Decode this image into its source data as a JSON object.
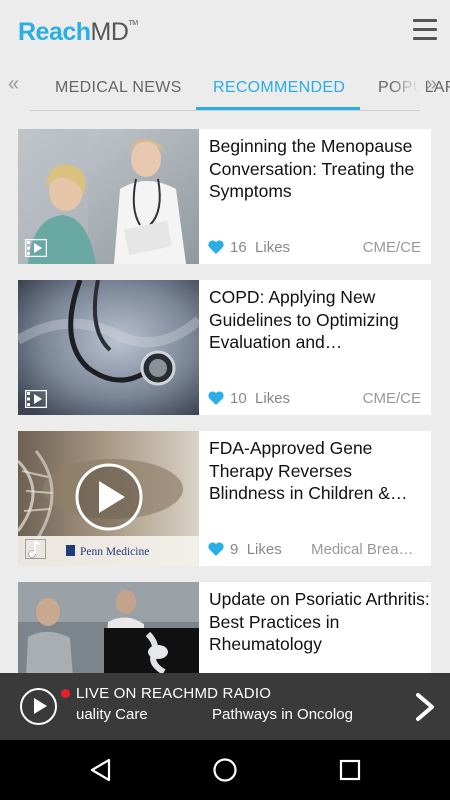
{
  "header": {
    "logo_reach": "Reach",
    "logo_md": "MD",
    "logo_tm": "TM",
    "menu_icon": "hamburger-menu-icon"
  },
  "tabs": {
    "items": [
      {
        "label": "MEDICAL NEWS",
        "active": false
      },
      {
        "label": "RECOMMENDED",
        "active": true
      },
      {
        "label": "POPULAR",
        "active": false
      }
    ],
    "left_arrow_icon": "double-chevron-left-icon",
    "right_arrow_icon": "double-chevron-right-icon",
    "accent_color": "#29aee6"
  },
  "cards": [
    {
      "title": "Beginning the Menopause Conversation: Treating the Symptoms",
      "likes_count": "16",
      "likes_label": "Likes",
      "category": "CME/CE",
      "media_icon": "video-icon",
      "thumbnail": "doctor-consulting-patient"
    },
    {
      "title": "COPD: Applying New Guidelines to Optimizing Evaluation and Management",
      "likes_count": "10",
      "likes_label": "Likes",
      "category": "CME/CE",
      "media_icon": "video-icon",
      "thumbnail": "stethoscope"
    },
    {
      "title": "FDA-Approved Gene Therapy Reverses Blindness in Children & Adults",
      "likes_count": "9",
      "likes_label": "Likes",
      "category": "Medical Breakthroughs",
      "media_icon": "audio-icon",
      "thumbnail": "dna-eye-play",
      "sponsor": "Penn Medicine"
    },
    {
      "title": "Update on Psoriatic Arthritis: Best Practices in Rheumatology",
      "likes_count": "",
      "likes_label": "",
      "category": "",
      "media_icon": "video-icon",
      "thumbnail": "knee-xray-consult"
    }
  ],
  "radio": {
    "live_label": "LIVE ON REACHMD RADIO",
    "ticker_items": [
      "uality Care",
      "Pathways in Oncolog"
    ],
    "live_color": "#e8202a"
  },
  "nav": {
    "back_icon": "back-triangle-icon",
    "home_icon": "home-circle-icon",
    "recents_icon": "recents-square-icon"
  }
}
